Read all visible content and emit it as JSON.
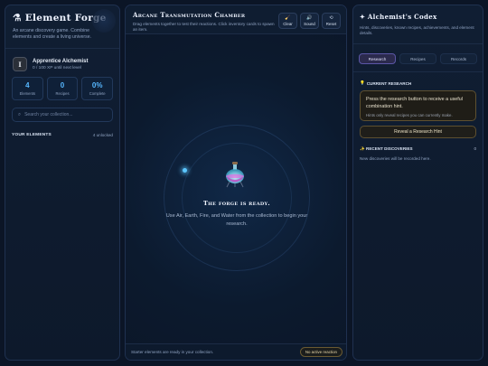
{
  "left": {
    "icon": "alembic-icon",
    "brand_glyph": "⚗",
    "title": "Element Forge",
    "subtitle": "An arcane discovery game. Combine elements and create a living universe.",
    "rank_badge": "I",
    "rank_name": "Apprentice Alchemist",
    "rank_xp": "0 / 100 XP until next level",
    "stats": [
      {
        "value": "4",
        "label": "Elements"
      },
      {
        "value": "0",
        "label": "Recipes"
      },
      {
        "value": "0%",
        "label": "Complete"
      }
    ],
    "search_placeholder": "Search your collection...",
    "elements_title": "YOUR ELEMENTS",
    "elements_meta": "4 unlocked"
  },
  "mid": {
    "title": "Arcane Transmutation Chamber",
    "subtitle": "Drag elements together to test their reactions. Click inventory cards to spawn an item.",
    "tools": [
      {
        "icon": "broom-icon",
        "glyph": "🧹",
        "label": "Clear"
      },
      {
        "icon": "speaker-icon",
        "glyph": "🔊",
        "label": "Sound"
      },
      {
        "icon": "reset-icon",
        "glyph": "⟲",
        "label": "Reset"
      }
    ],
    "forge_title": "The forge is ready.",
    "forge_text": "Use Air, Earth, Fire, and Water from the collection to begin your research.",
    "footer_text": "Starter elements are ready in your collection.",
    "reaction_badge": "No active reaction"
  },
  "right": {
    "title_glyph": "✦",
    "title": "Alchemist's Codex",
    "subtitle": "Hints, discoveries, known recipes, achievements, and element details.",
    "tabs": [
      {
        "label": "Research",
        "active": true
      },
      {
        "label": "Recipes",
        "active": false
      },
      {
        "label": "Records",
        "active": false
      }
    ],
    "research_glyph": "💡",
    "research_title": "CURRENT RESEARCH",
    "hint_main": "Press the research button to receive a useful combination hint.",
    "hint_sub": "Hints only reveal recipes you can currently make.",
    "hint_button": "Reveal a Research Hint",
    "discoveries_glyph": "✨",
    "discoveries_title": "RECENT DISCOVERIES",
    "discoveries_count": "0",
    "discoveries_empty": "New discoveries will be recorded here."
  },
  "colors": {
    "accent": "#57b7ff",
    "gold": "#e8d7a8",
    "active_tab": "#2b2a4d",
    "background": "#0b1526"
  }
}
